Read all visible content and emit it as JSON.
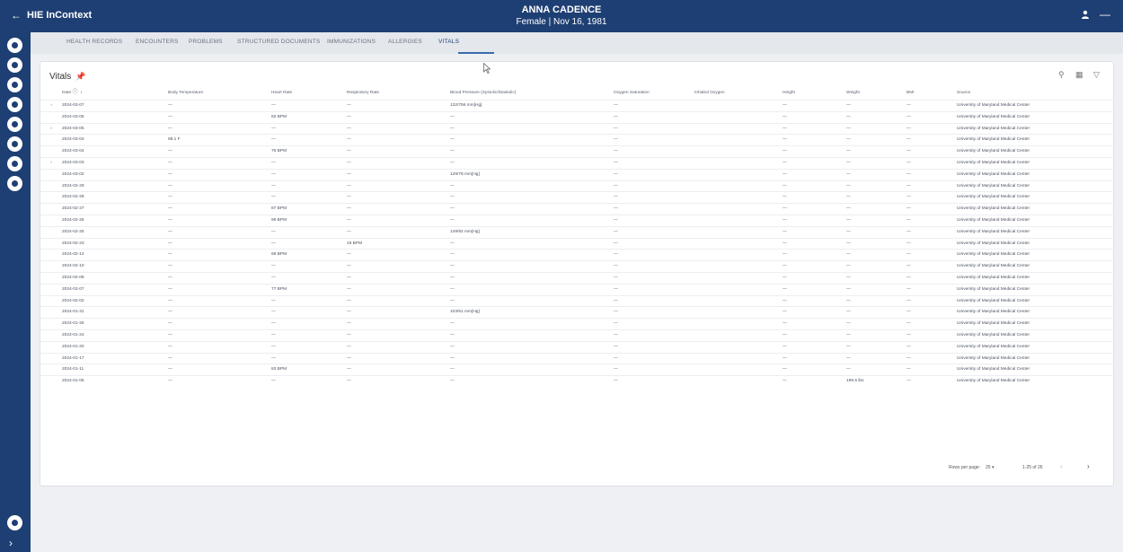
{
  "header": {
    "back_icon": "arrow-left-icon",
    "app_title": "HIE InContext",
    "patient_name": "ANNA CADENCE",
    "patient_info": "Female | Nov 16, 1981",
    "minimize_label": "—"
  },
  "tabs": [
    {
      "label": "HEALTH RECORDS"
    },
    {
      "label": "ENCOUNTERS"
    },
    {
      "label": "PROBLEMS"
    },
    {
      "label": "STRUCTURED DOCUMENTS"
    },
    {
      "label": "IMMUNIZATIONS"
    },
    {
      "label": "ALLERGIES"
    },
    {
      "label": "VITALS"
    }
  ],
  "active_tab": "VITALS",
  "vitals": {
    "title": "Vitals",
    "columns": [
      "Date",
      "Body Temperature",
      "Heart Rate",
      "Respiratory Rate",
      "Blood Pressure (Systolic/Diastolic)",
      "Oxygen Saturation",
      "Inhaled Oxygen",
      "Height",
      "Weight",
      "BMI",
      "Source"
    ],
    "rows": [
      {
        "chevron": "›",
        "cells": [
          "2024-03-07",
          "—",
          "—",
          "—",
          "132/756 mm[Hg]",
          "—",
          "",
          "—",
          "—",
          "—",
          "University of Maryland Medical Center"
        ]
      },
      {
        "chevron": "",
        "cells": [
          "2024-03-06",
          "—",
          "82 BPM",
          "—",
          "—",
          "—",
          "",
          "—",
          "—",
          "—",
          "University of Maryland Medical Center"
        ]
      },
      {
        "chevron": "›",
        "cells": [
          "2024-03-05",
          "—",
          "—",
          "—",
          "—",
          "—",
          "",
          "—",
          "—",
          "—",
          "University of Maryland Medical Center"
        ]
      },
      {
        "chevron": "",
        "cells": [
          "2024-03-04",
          "98.1 F",
          "—",
          "—",
          "—",
          "—",
          "",
          "—",
          "—",
          "—",
          "University of Maryland Medical Center"
        ]
      },
      {
        "chevron": "",
        "cells": [
          "2024-03-04",
          "—",
          "76 BPM",
          "—",
          "—",
          "—",
          "",
          "—",
          "—",
          "—",
          "University of Maryland Medical Center"
        ]
      },
      {
        "chevron": "›",
        "cells": [
          "2024-03-03",
          "—",
          "—",
          "—",
          "—",
          "—",
          "",
          "—",
          "—",
          "—",
          "University of Maryland Medical Center"
        ]
      },
      {
        "chevron": "",
        "cells": [
          "2024-03-02",
          "—",
          "—",
          "—",
          "129/79 mm[Hg]",
          "—",
          "",
          "—",
          "—",
          "—",
          "University of Maryland Medical Center"
        ]
      },
      {
        "chevron": "",
        "cells": [
          "2024-02-29",
          "—",
          "—",
          "—",
          "—",
          "—",
          "",
          "—",
          "—",
          "—",
          "University of Maryland Medical Center"
        ]
      },
      {
        "chevron": "",
        "cells": [
          "2024-02-28",
          "—",
          "—",
          "—",
          "—",
          "—",
          "",
          "—",
          "—",
          "—",
          "University of Maryland Medical Center"
        ]
      },
      {
        "chevron": "",
        "cells": [
          "2024-02-27",
          "—",
          "87 BPM",
          "—",
          "—",
          "—",
          "",
          "—",
          "—",
          "—",
          "University of Maryland Medical Center"
        ]
      },
      {
        "chevron": "",
        "cells": [
          "2024-02-26",
          "—",
          "96 BPM",
          "—",
          "—",
          "—",
          "",
          "—",
          "—",
          "—",
          "University of Maryland Medical Center"
        ]
      },
      {
        "chevron": "",
        "cells": [
          "2024-02-25",
          "—",
          "—",
          "—",
          "149/92 mm[Hg]",
          "—",
          "",
          "—",
          "—",
          "—",
          "University of Maryland Medical Center"
        ]
      },
      {
        "chevron": "",
        "cells": [
          "2024-02-23",
          "—",
          "—",
          "19 BPM",
          "—",
          "—",
          "",
          "—",
          "—",
          "—",
          "University of Maryland Medical Center"
        ]
      },
      {
        "chevron": "",
        "cells": [
          "2024-02-14",
          "—",
          "68 BPM",
          "—",
          "—",
          "—",
          "",
          "—",
          "—",
          "—",
          "University of Maryland Medical Center"
        ]
      },
      {
        "chevron": "",
        "cells": [
          "2024-02-10",
          "—",
          "—",
          "—",
          "—",
          "—",
          "",
          "—",
          "—",
          "—",
          "University of Maryland Medical Center"
        ]
      },
      {
        "chevron": "",
        "cells": [
          "2024-02-09",
          "—",
          "—",
          "—",
          "—",
          "—",
          "",
          "—",
          "—",
          "—",
          "University of Maryland Medical Center"
        ]
      },
      {
        "chevron": "",
        "cells": [
          "2024-02-07",
          "—",
          "77 BPM",
          "—",
          "—",
          "—",
          "",
          "—",
          "—",
          "—",
          "University of Maryland Medical Center"
        ]
      },
      {
        "chevron": "",
        "cells": [
          "2024-02-02",
          "—",
          "—",
          "—",
          "—",
          "—",
          "",
          "—",
          "—",
          "—",
          "University of Maryland Medical Center"
        ]
      },
      {
        "chevron": "",
        "cells": [
          "2024-01-31",
          "—",
          "—",
          "—",
          "103/61 mm[Hg]",
          "—",
          "",
          "—",
          "—",
          "—",
          "University of Maryland Medical Center"
        ]
      },
      {
        "chevron": "",
        "cells": [
          "2024-01-26",
          "—",
          "—",
          "—",
          "—",
          "—",
          "",
          "—",
          "—",
          "—",
          "University of Maryland Medical Center"
        ]
      },
      {
        "chevron": "",
        "cells": [
          "2024-01-24",
          "—",
          "—",
          "—",
          "—",
          "—",
          "",
          "—",
          "—",
          "—",
          "University of Maryland Medical Center"
        ]
      },
      {
        "chevron": "",
        "cells": [
          "2024-01-20",
          "—",
          "—",
          "—",
          "—",
          "—",
          "",
          "—",
          "—",
          "—",
          "University of Maryland Medical Center"
        ]
      },
      {
        "chevron": "",
        "cells": [
          "2024-01-17",
          "—",
          "—",
          "—",
          "—",
          "—",
          "",
          "—",
          "—",
          "—",
          "University of Maryland Medical Center"
        ]
      },
      {
        "chevron": "",
        "cells": [
          "2024-01-11",
          "—",
          "83 BPM",
          "—",
          "—",
          "—",
          "",
          "—",
          "—",
          "—",
          "University of Maryland Medical Center"
        ]
      },
      {
        "chevron": "",
        "cells": [
          "2024-01-05",
          "—",
          "—",
          "—",
          "—",
          "—",
          "",
          "—",
          "199.5 lbs",
          "—",
          "University of Maryland Medical Center"
        ]
      }
    ],
    "footer": {
      "rows_per_page_label": "Rows per page:",
      "rows_per_page_value": "25",
      "range": "1-25 of 26"
    }
  },
  "icons": {
    "search": "search-icon",
    "columns": "columns-icon",
    "filter": "filter-icon",
    "info": "info-icon",
    "sort": "sort-arrow-icon",
    "pin": "pin-icon",
    "user": "user-icon"
  },
  "colors": {
    "navy": "#1e3f73",
    "tab_bg": "#e4e7ec",
    "page_bg": "#eef0f3",
    "active_tab": "#3a6ab0"
  }
}
